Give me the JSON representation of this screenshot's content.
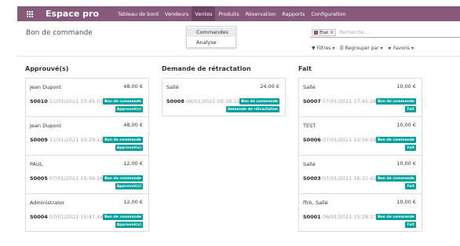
{
  "navbar": {
    "brand": "Espace pro",
    "items": [
      "Tableau de bord",
      "Vendeurs",
      "Ventes",
      "Produits",
      "Réservation",
      "Rapports",
      "Configuration"
    ],
    "active_index": 2,
    "color": "#875a7b"
  },
  "dropdown": {
    "items": [
      "Commandes",
      "Analyse"
    ],
    "active_index": 0
  },
  "control_panel": {
    "title": "Bon de commande",
    "facet_label": "État",
    "facet_close": "×",
    "search_placeholder": "Recherche...",
    "filters_label": "Filtres",
    "groupby_label": "Regrouper par",
    "favorites_label": "Favoris"
  },
  "columns": [
    {
      "title": "Approuvé(s)",
      "cards": [
        {
          "name": "Jean Dupont",
          "amount": "48,00 €",
          "ref": "S0010",
          "date": "11/01/2021 10:45:01",
          "tags": [
            "Bon de commande",
            "Approuvé(s)"
          ]
        },
        {
          "name": "Jean Dupont",
          "amount": "48,00 €",
          "ref": "S0009",
          "date": "11/01/2021 10:29:12",
          "tags": [
            "Bon de commande",
            "Approuvé(s)"
          ]
        },
        {
          "name": "PAUL",
          "amount": "12,00 €",
          "ref": "S0005",
          "date": "07/01/2021 15:56:16",
          "tags": [
            "Bon de commande",
            "Approuvé(s)"
          ]
        },
        {
          "name": "Administrator",
          "amount": "12,00 €",
          "ref": "S0004",
          "date": "07/01/2021 15:47:46",
          "tags": [
            "Bon de commande",
            "Approuvé(s)"
          ]
        }
      ]
    },
    {
      "title": "Demande de rétractation",
      "cards": [
        {
          "name": "Sallé",
          "amount": "24,00 €",
          "ref": "S0008",
          "date": "08/01/2021 09:39:11",
          "tags": [
            "Bon de commande",
            "Demande de rétractation"
          ]
        }
      ]
    },
    {
      "title": "Fait",
      "cards": [
        {
          "name": "Sallé",
          "amount": "10,00 €",
          "ref": "S0007",
          "date": "07/01/2021 17:45:28",
          "tags": [
            "Bon de commande",
            "Fait"
          ]
        },
        {
          "name": "TEST",
          "amount": "10,00 €",
          "ref": "S0006",
          "date": "07/01/2021 15:56:55",
          "tags": [
            "Bon de commande",
            "Fait"
          ]
        },
        {
          "name": "Sallé",
          "amount": "10,00 €",
          "ref": "S0003",
          "date": "07/01/2021 16:32:42",
          "tags": [
            "Bon de commande",
            "Fait"
          ]
        },
        {
          "name": "ffck, Sallé",
          "amount": "10,00 €",
          "ref": "S0001",
          "date": "06/01/2021 15:28:17",
          "tags": [
            "Bon de commande",
            "Fait"
          ]
        }
      ]
    }
  ],
  "colors": {
    "primary": "#875a7b",
    "active_menu": "#6c4563",
    "tag": "#00a09d"
  }
}
